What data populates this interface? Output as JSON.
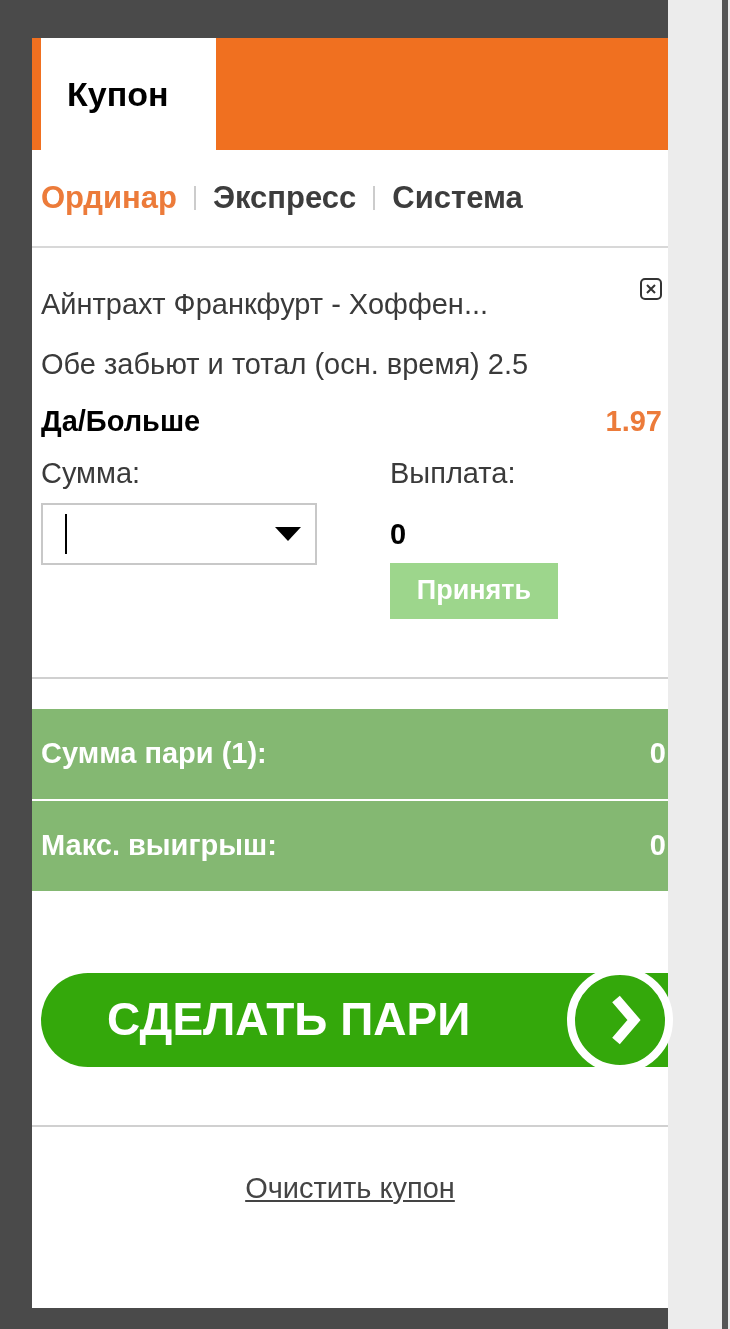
{
  "header": {
    "tabs": [
      {
        "label": "Купон",
        "selected": true
      }
    ]
  },
  "bet_types": [
    {
      "label": "Ординар",
      "selected": true
    },
    {
      "label": "Экспресс",
      "selected": false
    },
    {
      "label": "Система",
      "selected": false
    }
  ],
  "bet": {
    "event": "Айнтрахт Франкфурт - Хоффен...",
    "market": "Обе забьют и тотал (осн. время) 2.5",
    "outcome": "Да/Больше",
    "odds": "1.97",
    "stake_label": "Сумма:",
    "payout_label": "Выплата:",
    "payout": "0",
    "accept_button": {
      "label": "Принять",
      "disabled": true
    }
  },
  "summary": [
    {
      "label": "Сумма пари (1):",
      "value": "0"
    },
    {
      "label": "Макс. выигрыш:",
      "value": "0"
    }
  ],
  "place_bet_button": "СДЕЛАТЬ ПАРИ",
  "clear_link": "Очистить купон"
}
